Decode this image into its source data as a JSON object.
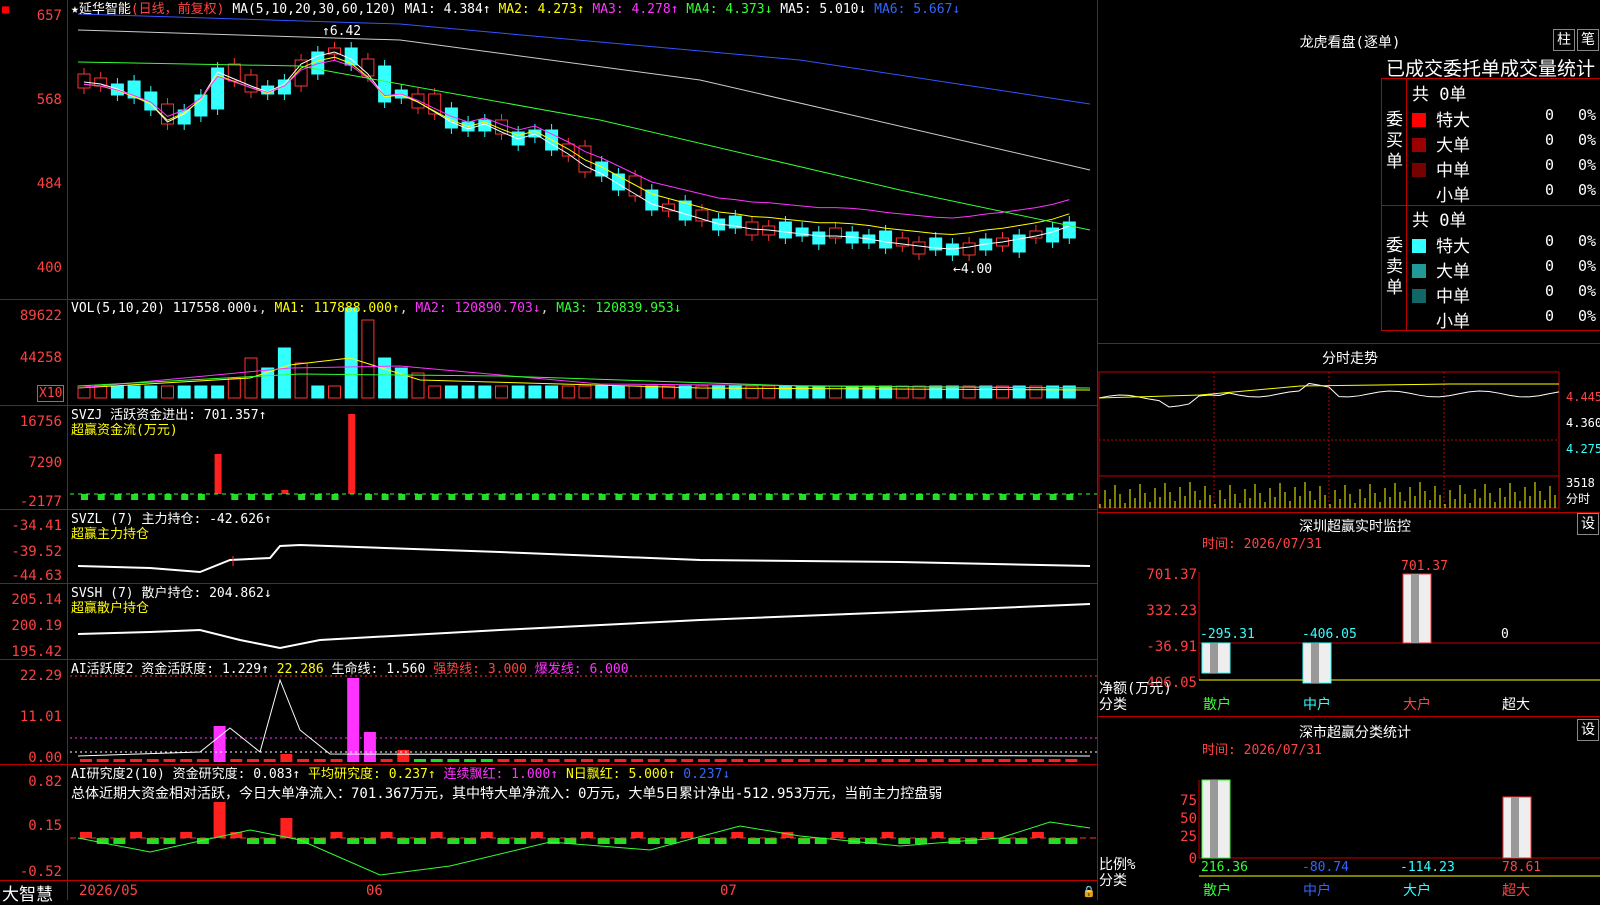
{
  "stock": {
    "star": "★",
    "name": "延华智能",
    "period": "(日线，前复权)"
  },
  "ma_line": {
    "label": "MA(5,10,20,30,60,120)",
    "ma1": "MA1: 4.384↑",
    "ma2": "MA2: 4.273↑",
    "ma3": "MA3: 4.278↑",
    "ma4": "MA4: 4.373↓",
    "ma5": "MA5: 5.010↓",
    "ma6": "MA6: 5.667↓"
  },
  "price_axis": [
    "657",
    "568",
    "484",
    "400"
  ],
  "price_marks": {
    "high": "6.42",
    "low": "4.00"
  },
  "vol_line": {
    "label": "VOL(5,10,20)",
    "v": "117558.000↓",
    "ma1": "MA1: 117888.000↑",
    "ma2": "MA2: 120890.703↓",
    "ma3": "MA3: 120839.953↓"
  },
  "vol_axis": [
    "89622",
    "44258"
  ],
  "vol_unit": "X10",
  "svzj": {
    "label": "SVZJ  活跃资金进出: 701.357↑",
    "sub": "超赢资金流(万元)",
    "axis": [
      "16756",
      "7290",
      "-2177"
    ]
  },
  "svzl": {
    "label": "SVZL (7) 主力持仓: -42.626↑",
    "sub": "超赢主力持仓",
    "axis": [
      "-34.41",
      "-39.52",
      "-44.63"
    ]
  },
  "svsh": {
    "label": "SVSH (7) 散户持仓: 204.862↓",
    "sub": "超赢散户持仓",
    "axis": [
      "205.14",
      "200.19",
      "195.42"
    ]
  },
  "ai2": {
    "p1": "AI活跃度2 资金活跃度: 1.229↑",
    "p2": " 22.286",
    "p3": " 生命线: 1.560",
    "p4": " 强势线: 3.000",
    "p5": " 爆发线: 6.000",
    "axis": [
      "22.29",
      "11.01",
      "0.00"
    ]
  },
  "ai_res": {
    "p1": "AI研究度2(10) 资金研究度: 0.083↑",
    "p2": " 平均研究度: 0.237↑",
    "p3": " 连续飘红: 1.000↑",
    "p4": " N日飘红: 5.000↑",
    "p5": " 0.237↓",
    "summary": "总体近期大资金相对活跃，今日大单净流入：701.367万元，其中特大单净流入：0万元，大单5日累计净出-512.953万元，当前主力控盘弱",
    "axis": [
      "0.82",
      "0.15",
      "-0.52"
    ]
  },
  "date_axis": [
    "2026/05",
    "06",
    "07"
  ],
  "brand": "大智慧",
  "lhkp": {
    "title": "龙虎看盘(逐单)",
    "btn1": "柱",
    "btn2": "笔",
    "subtitle": "已成交委托单成交量统计",
    "buy": {
      "label": "委买单",
      "total": "共 0单",
      "rows": [
        {
          "name": "特大",
          "n": "0",
          "p": "0%",
          "color": "#ff0000"
        },
        {
          "name": "大单",
          "n": "0",
          "p": "0%",
          "color": "#990000"
        },
        {
          "name": "中单",
          "n": "0",
          "p": "0%",
          "color": "#770000"
        },
        {
          "name": "小单",
          "n": "0",
          "p": "0%",
          "color": "#000000"
        }
      ]
    },
    "sell": {
      "label": "委卖单",
      "total": "共 0单",
      "rows": [
        {
          "name": "特大",
          "n": "0",
          "p": "0%",
          "color": "#33ffff"
        },
        {
          "name": "大单",
          "n": "0",
          "p": "0%",
          "color": "#229999"
        },
        {
          "name": "中单",
          "n": "0",
          "p": "0%",
          "color": "#116666"
        },
        {
          "name": "小单",
          "n": "0",
          "p": "0%",
          "color": "#000000"
        }
      ]
    }
  },
  "fenshi": {
    "title": "分时走势",
    "axis": [
      "4.445",
      "4.360",
      "4.275",
      "3518"
    ],
    "unit": "分时"
  },
  "monitor": {
    "title": "深圳超赢实时监控",
    "btn": "设",
    "time": "时间: 2026/07/31",
    "axis": [
      "701.37",
      "332.23",
      "-36.91",
      "-406.05"
    ],
    "ylabel": "净额(万元)",
    "xlabel": "分类",
    "vals": [
      "-295.31",
      "-406.05",
      "701.37",
      "0"
    ],
    "cats": [
      "散户",
      "中户",
      "大户",
      "超大"
    ]
  },
  "classify": {
    "title": "深市超赢分类统计",
    "btn": "设",
    "time": "时间: 2026/07/31",
    "axis": [
      "75",
      "50",
      "25",
      "0"
    ],
    "ylabel": "比例%",
    "xlabel": "分类",
    "vals": [
      "216.36",
      "-80.74",
      "-114.23",
      "78.61"
    ],
    "cats": [
      "散户",
      "中户",
      "大户",
      "超大"
    ]
  }
}
